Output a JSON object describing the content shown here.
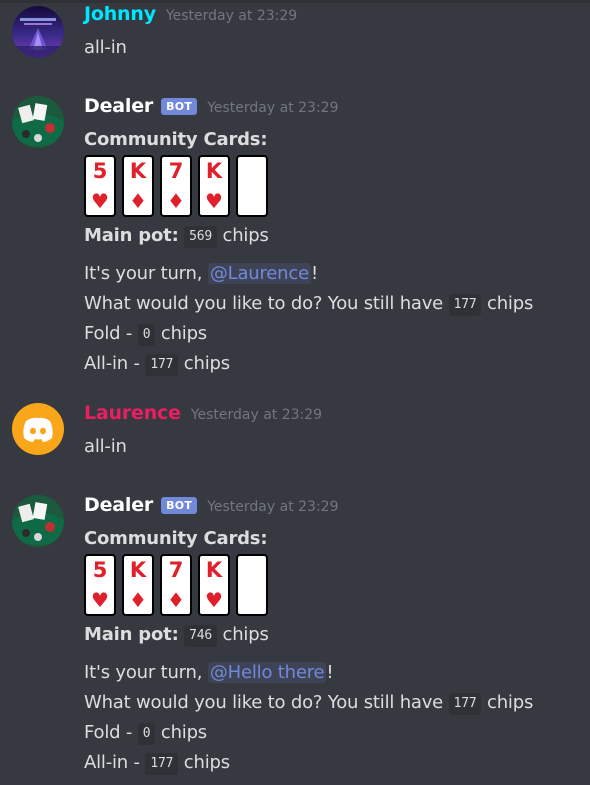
{
  "colors": {
    "background": "#36393f",
    "johnny": "#00e6ff",
    "laurence": "#e91e63",
    "mention": "#7289da",
    "bot_tag": "#7289da"
  },
  "messages": [
    {
      "author": "Johnny",
      "timestamp": "Yesterday at 23:29",
      "text": "all-in"
    },
    {
      "author": "Dealer",
      "bot_tag": "BOT",
      "timestamp": "Yesterday at 23:29",
      "community_label": "Community Cards:",
      "cards": [
        {
          "rank": "5",
          "suit": "♥"
        },
        {
          "rank": "K",
          "suit": "♦"
        },
        {
          "rank": "7",
          "suit": "♦"
        },
        {
          "rank": "K",
          "suit": "♥"
        },
        {
          "rank": "",
          "suit": ""
        }
      ],
      "pot_label": "Main pot:",
      "pot_value": "569",
      "chips_word": "chips",
      "turn_prefix": "It's your turn,",
      "mention": "@Laurence",
      "turn_suffix": "!",
      "ask_text": "What would you like to do? You still have",
      "remaining": "177",
      "fold_label": "Fold -",
      "fold_value": "0",
      "allin_label": "All-in -",
      "allin_value": "177"
    },
    {
      "author": "Laurence",
      "timestamp": "Yesterday at 23:29",
      "text": "all-in",
      "avatar_icon": "discord-logo-icon"
    },
    {
      "author": "Dealer",
      "bot_tag": "BOT",
      "timestamp": "Yesterday at 23:29",
      "community_label": "Community Cards:",
      "cards": [
        {
          "rank": "5",
          "suit": "♥"
        },
        {
          "rank": "K",
          "suit": "♦"
        },
        {
          "rank": "7",
          "suit": "♦"
        },
        {
          "rank": "K",
          "suit": "♥"
        },
        {
          "rank": "",
          "suit": ""
        }
      ],
      "pot_label": "Main pot:",
      "pot_value": "746",
      "chips_word": "chips",
      "turn_prefix": "It's your turn,",
      "mention": "@Hello there",
      "turn_suffix": "!",
      "ask_text": "What would you like to do? You still have",
      "remaining": "177",
      "fold_label": "Fold -",
      "fold_value": "0",
      "allin_label": "All-in -",
      "allin_value": "177"
    }
  ]
}
